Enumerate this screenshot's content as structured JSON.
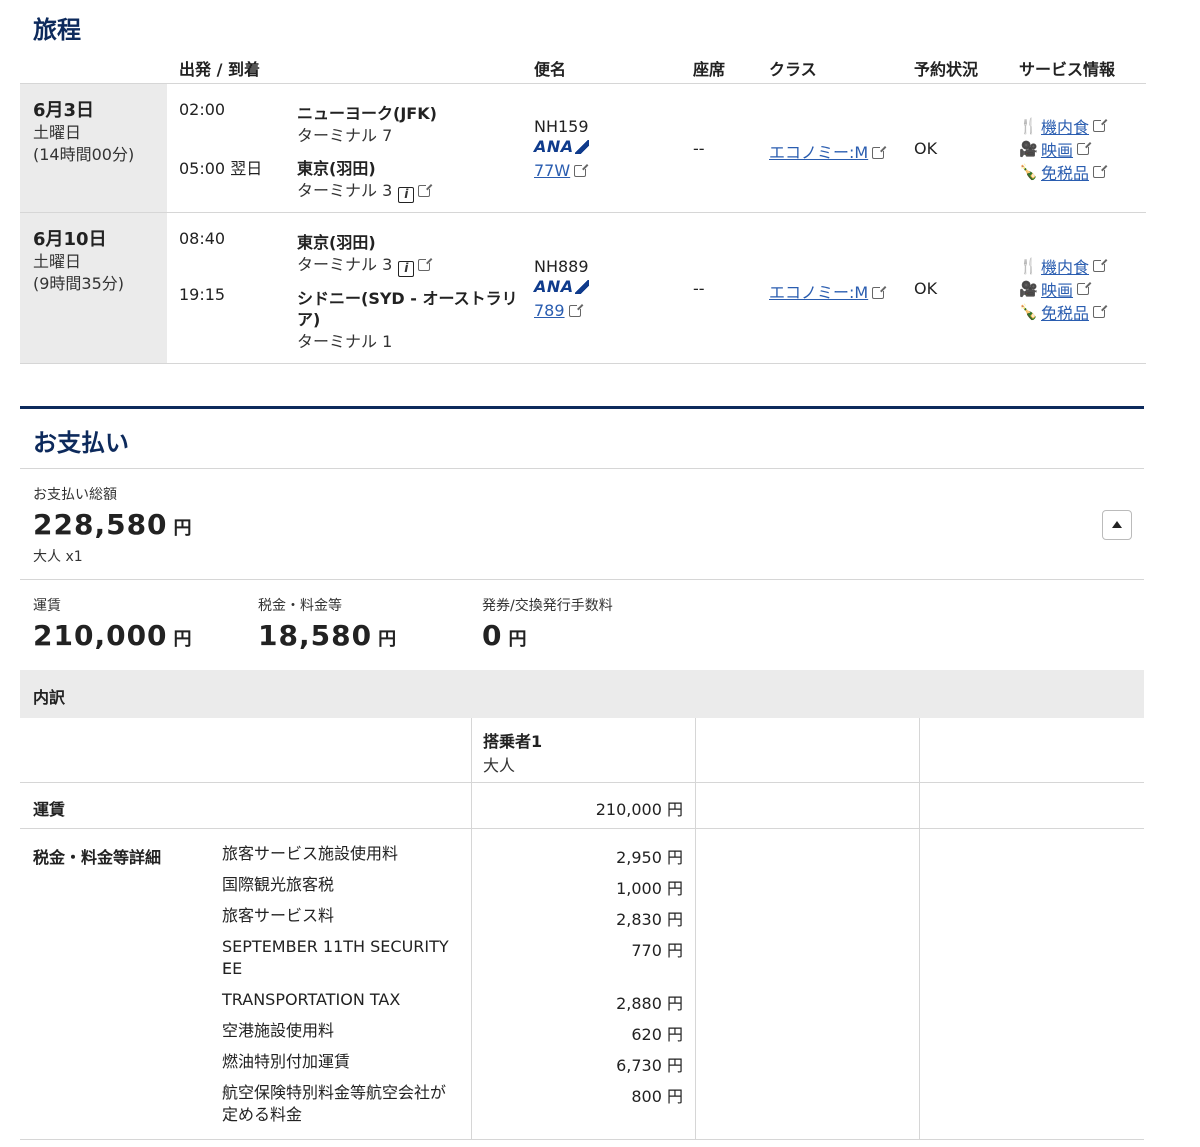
{
  "itinerary": {
    "title": "旅程",
    "headers": {
      "depart_arrive": "出発 / 到着",
      "flight": "便名",
      "seat": "座席",
      "class": "クラス",
      "status": "予約状況",
      "service": "サービス情報"
    },
    "segments": [
      {
        "date": "6月3日",
        "weekday": "土曜日",
        "duration": "(14時間00分)",
        "dep_time": "02:00",
        "dep_city": "ニューヨーク(JFK)",
        "dep_terminal": "ターミナル 7",
        "arr_time": "05:00 翌日",
        "arr_city": "東京(羽田)",
        "arr_terminal": "ターミナル 3",
        "flight_no": "NH159",
        "airline": "ANA",
        "aircraft": "77W",
        "seat": "--",
        "class": "エコノミー:M",
        "status": "OK",
        "services": [
          "機内食",
          "映画",
          "免税品"
        ]
      },
      {
        "date": "6月10日",
        "weekday": "土曜日",
        "duration": "(9時間35分)",
        "dep_time": "08:40",
        "dep_city": "東京(羽田)",
        "dep_terminal": "ターミナル 3",
        "arr_time": "19:15",
        "arr_city": "シドニー(SYD - オーストラリ",
        "arr_city2": "ア)",
        "arr_terminal": "ターミナル 1",
        "flight_no": "NH889",
        "airline": "ANA",
        "aircraft": "789",
        "seat": "--",
        "class": "エコノミー:M",
        "status": "OK",
        "services": [
          "機内食",
          "映画",
          "免税品"
        ]
      }
    ]
  },
  "payment": {
    "title": "お支払い",
    "total_label": "お支払い総額",
    "total": "228,580",
    "yen": "円",
    "pax": "大人 x1",
    "fare_label": "運賃",
    "fare": "210,000",
    "tax_label": "税金・料金等",
    "tax": "18,580",
    "fee_label": "発券/交換発行手数料",
    "fee": "0"
  },
  "breakdown": {
    "title": "内訳",
    "passenger": "搭乗者1",
    "passenger_type": "大人",
    "fare_label": "運賃",
    "fare_amount": "210,000 円",
    "tax_detail_label": "税金・料金等詳細",
    "items": [
      {
        "label": "旅客サービス施設使用料",
        "amount": "2,950 円"
      },
      {
        "label": "国際観光旅客税",
        "amount": "1,000 円"
      },
      {
        "label": "旅客サービス料",
        "amount": "2,830 円"
      },
      {
        "label": "SEPTEMBER 11TH SECURITY F",
        "label2": "EE",
        "amount": "770 円"
      },
      {
        "label": "TRANSPORTATION TAX",
        "amount": "2,880 円"
      },
      {
        "label": "空港施設使用料",
        "amount": "620 円"
      },
      {
        "label": "燃油特別付加運賃",
        "amount": "6,730 円"
      },
      {
        "label": "航空保険特別料金等航空会社が",
        "label2": "定める料金",
        "amount": "800 円"
      }
    ]
  }
}
